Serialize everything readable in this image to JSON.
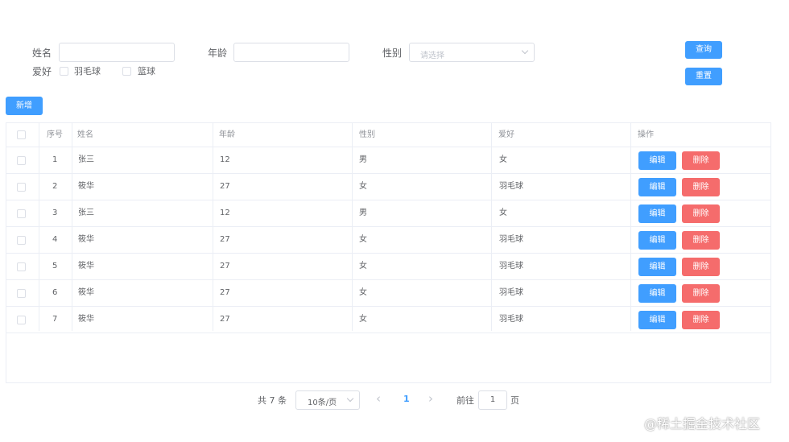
{
  "form": {
    "name_label": "姓名",
    "name_value": "",
    "age_label": "年龄",
    "age_value": "",
    "gender_label": "性别",
    "gender_placeholder": "请选择",
    "hobby_label": "爱好",
    "hobby_options": [
      "羽毛球",
      "篮球"
    ],
    "query_button": "查询",
    "reset_button": "重置"
  },
  "toolbar": {
    "add_button": "新增"
  },
  "table": {
    "headers": [
      "序号",
      "姓名",
      "年龄",
      "性别",
      "爱好",
      "操作"
    ],
    "rows": [
      {
        "index": "1",
        "name": "张三",
        "age": "12",
        "gender": "男",
        "hobby": "女"
      },
      {
        "index": "2",
        "name": "筱华",
        "age": "27",
        "gender": "女",
        "hobby": "羽毛球"
      },
      {
        "index": "3",
        "name": "张三",
        "age": "12",
        "gender": "男",
        "hobby": "女"
      },
      {
        "index": "4",
        "name": "筱华",
        "age": "27",
        "gender": "女",
        "hobby": "羽毛球"
      },
      {
        "index": "5",
        "name": "筱华",
        "age": "27",
        "gender": "女",
        "hobby": "羽毛球"
      },
      {
        "index": "6",
        "name": "筱华",
        "age": "27",
        "gender": "女",
        "hobby": "羽毛球"
      },
      {
        "index": "7",
        "name": "筱华",
        "age": "27",
        "gender": "女",
        "hobby": "羽毛球"
      }
    ],
    "edit_label": "编辑",
    "delete_label": "删除"
  },
  "pagination": {
    "total_text": "共 7 条",
    "page_size": "10条/页",
    "prev_icon": "‹",
    "current_page": "1",
    "next_icon": "›",
    "goto_label": "前往",
    "goto_value": "1",
    "page_unit": "页"
  },
  "watermark": "@稀土掘金技术社区",
  "colors": {
    "primary": "#409eff",
    "danger": "#f56c6c",
    "border": "#ebeef5"
  }
}
